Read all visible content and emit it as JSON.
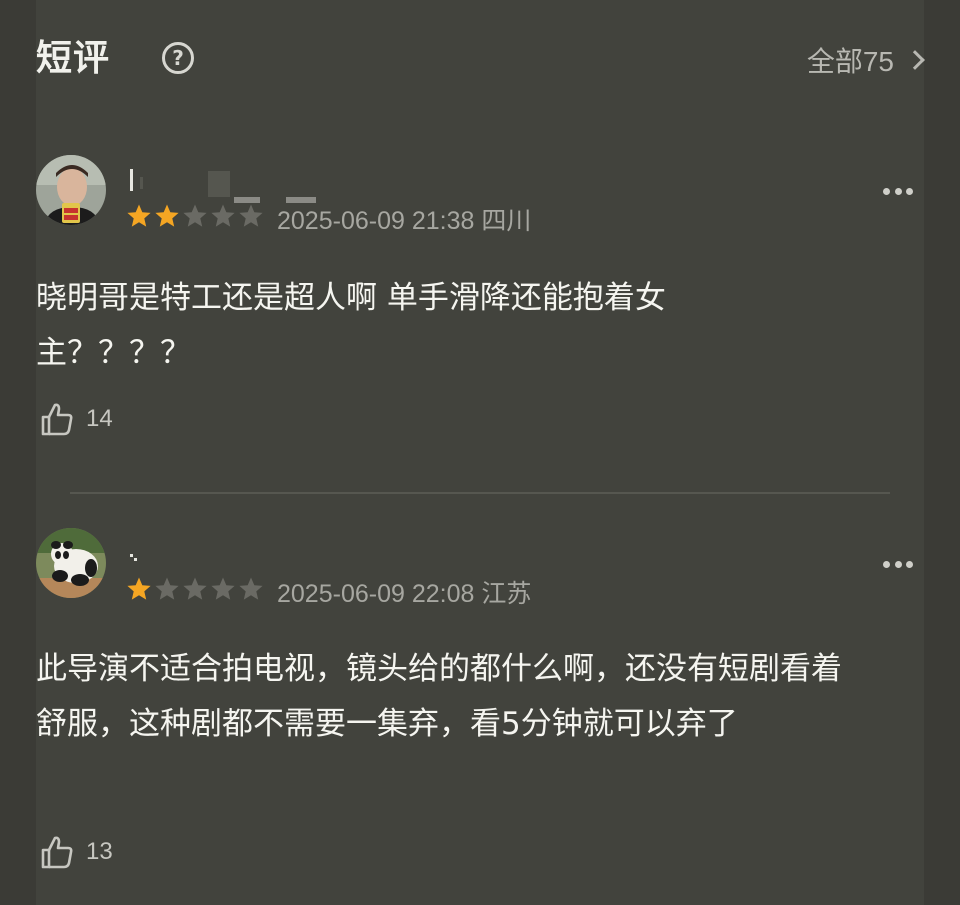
{
  "header": {
    "title": "短评",
    "help_icon": "?",
    "all_label": "全部75"
  },
  "comments": [
    {
      "user_name": "",
      "rating": 2,
      "max_rating": 5,
      "date": "2025-06-09 21:38",
      "location": "四川",
      "text": "晓明哥是特工还是超人啊 单手滑降还能抱着女主？？？？",
      "likes": "14",
      "avatar_icon": "person-avatar-icon"
    },
    {
      "user_name": "",
      "rating": 1,
      "max_rating": 5,
      "date": "2025-06-09 22:08",
      "location": "江苏",
      "text": "此导演不适合拍电视，镜头给的都什么啊，还没有短剧看着舒服，这种剧都不需要一集弃，看5分钟就可以弃了",
      "likes": "13",
      "avatar_icon": "panda-avatar-icon"
    }
  ],
  "colors": {
    "background": "#3b3b36",
    "card": "#42433d",
    "star_active": "#f5a623",
    "star_inactive": "#6a6a64",
    "text_primary": "#f5f5f0",
    "text_secondary": "#a7a7a1"
  }
}
